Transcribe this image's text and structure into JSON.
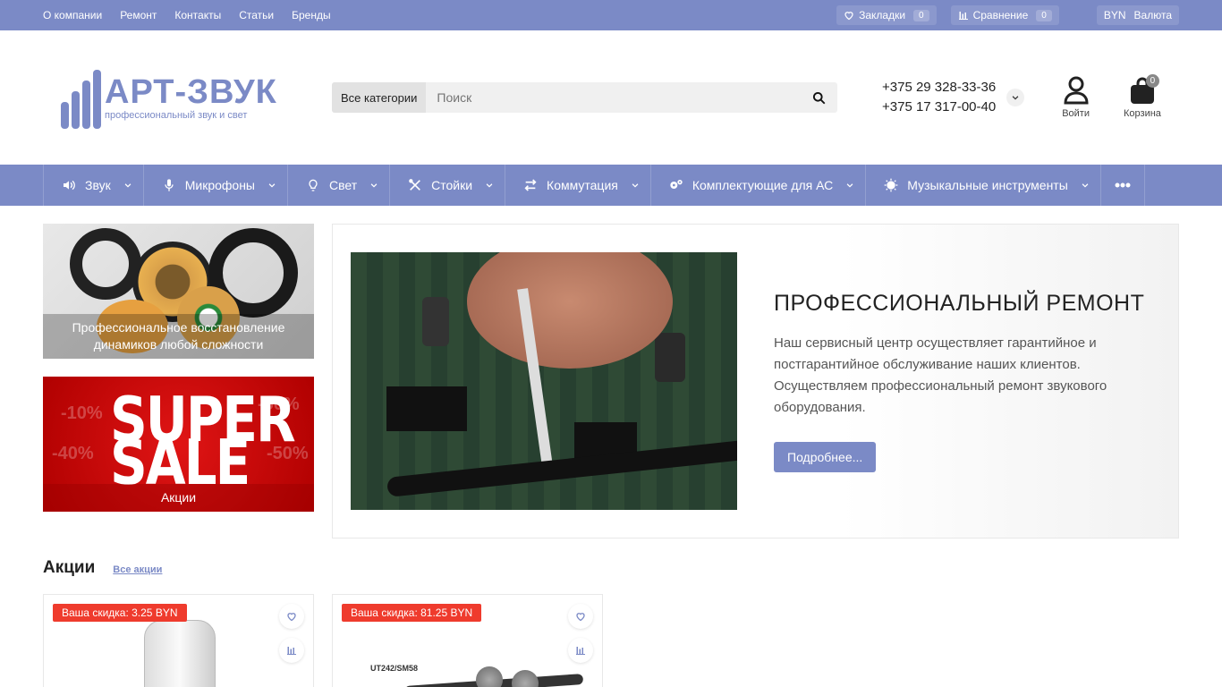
{
  "topbar": {
    "links": [
      "О компании",
      "Ремонт",
      "Контакты",
      "Статьи",
      "Бренды"
    ],
    "bookmarks_label": "Закладки",
    "bookmarks_count": "0",
    "compare_label": "Сравнение",
    "compare_count": "0",
    "currency_code": "BYN",
    "currency_label": "Валюта"
  },
  "header": {
    "logo_title": "АРТ-ЗВУК",
    "logo_sub": "профессиональный звук и свет",
    "search_category": "Все категории",
    "search_placeholder": "Поиск",
    "phone1": "+375 29 328-33-36",
    "phone2": "+375 17 317-00-40",
    "login_label": "Войти",
    "cart_label": "Корзина",
    "cart_count": "0"
  },
  "nav": {
    "items": [
      {
        "label": "Звук",
        "icon": "speaker-icon"
      },
      {
        "label": "Микрофоны",
        "icon": "microphone-icon"
      },
      {
        "label": "Свет",
        "icon": "lightbulb-icon"
      },
      {
        "label": "Стойки",
        "icon": "tools-icon"
      },
      {
        "label": "Коммутация",
        "icon": "exchange-icon"
      },
      {
        "label": "Комплектующие для АС",
        "icon": "gears-icon"
      },
      {
        "label": "Музыкальные инструменты",
        "icon": "sun-icon"
      }
    ]
  },
  "banners": {
    "repair_caption": "Профессиональное восстановление динамиков любой сложности",
    "sale_word1": "SUPER",
    "sale_word2": "SALE",
    "sale_caption": "Акции"
  },
  "hero": {
    "title": "ПРОФЕССИОНАЛЬНЫЙ РЕМОНТ",
    "description": "Наш сервисный центр осуществляет гарантийное и постгарантийное обслуживание наших клиентов. Осуществляем профессиональный ремонт звукового оборудования.",
    "button_label": "Подробнее..."
  },
  "promo": {
    "title": "Акции",
    "all_link": "Все акции",
    "cards": [
      {
        "discount": "Ваша скидка: 3.25 BYN"
      },
      {
        "discount": "Ваша скидка: 81.25 BYN",
        "image_text": "UT242/SM58"
      }
    ]
  },
  "colors": {
    "accent": "#7b8ac6",
    "discount": "#ef3b2d",
    "sale_red": "#d40f0f"
  }
}
